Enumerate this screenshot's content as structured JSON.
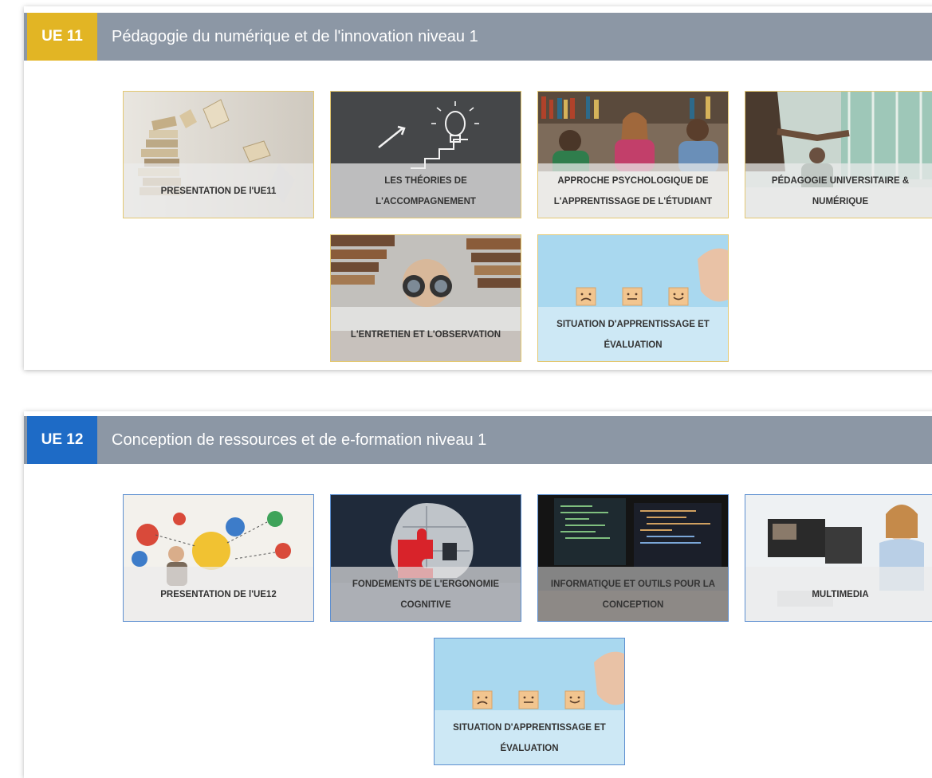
{
  "sections": [
    {
      "badge": "UE 11",
      "badge_color": "#e2b524",
      "title": "Pédagogie du numérique et de l'innovation niveau 1",
      "tiles": [
        {
          "label": "PRESENTATION DE l'UE11",
          "icon": "books-flying-image"
        },
        {
          "label": "LES THÉORIES DE L'ACCOMPAGNEMENT",
          "icon": "chalkboard-lightbulb-image"
        },
        {
          "label": "APPROCHE PSYCHOLOGIQUE DE L'APPRENTISSAGE DE L'ÉTUDIANT",
          "icon": "students-table-image"
        },
        {
          "label": "PÉDAGOGIE UNIVERSITAIRE & NUMÉRIQUE",
          "icon": "lecture-hall-image"
        },
        {
          "label": "L'ENTRETIEN ET L'OBSERVATION",
          "icon": "binoculars-image"
        },
        {
          "label": "SITUATION D'APPRENTISSAGE ET ÉVALUATION",
          "icon": "smiley-cubes-image"
        }
      ]
    },
    {
      "badge": "UE 12",
      "badge_color": "#1e6bc6",
      "title": "Conception de ressources et de e-formation niveau 1",
      "tiles": [
        {
          "label": "PRESENTATION DE l'UE12",
          "icon": "ideas-doodle-image"
        },
        {
          "label": "FONDEMENTS DE L'ERGONOMIE COGNITIVE",
          "icon": "puzzle-head-image"
        },
        {
          "label": "INFORMATIQUE ET OUTILS POUR LA CONCEPTION",
          "icon": "code-screens-image"
        },
        {
          "label": "MULTIMEDIA",
          "icon": "video-editing-image"
        },
        {
          "label": "SITUATION D'APPRENTISSAGE ET ÉVALUATION",
          "icon": "smiley-cubes-image"
        }
      ]
    }
  ]
}
